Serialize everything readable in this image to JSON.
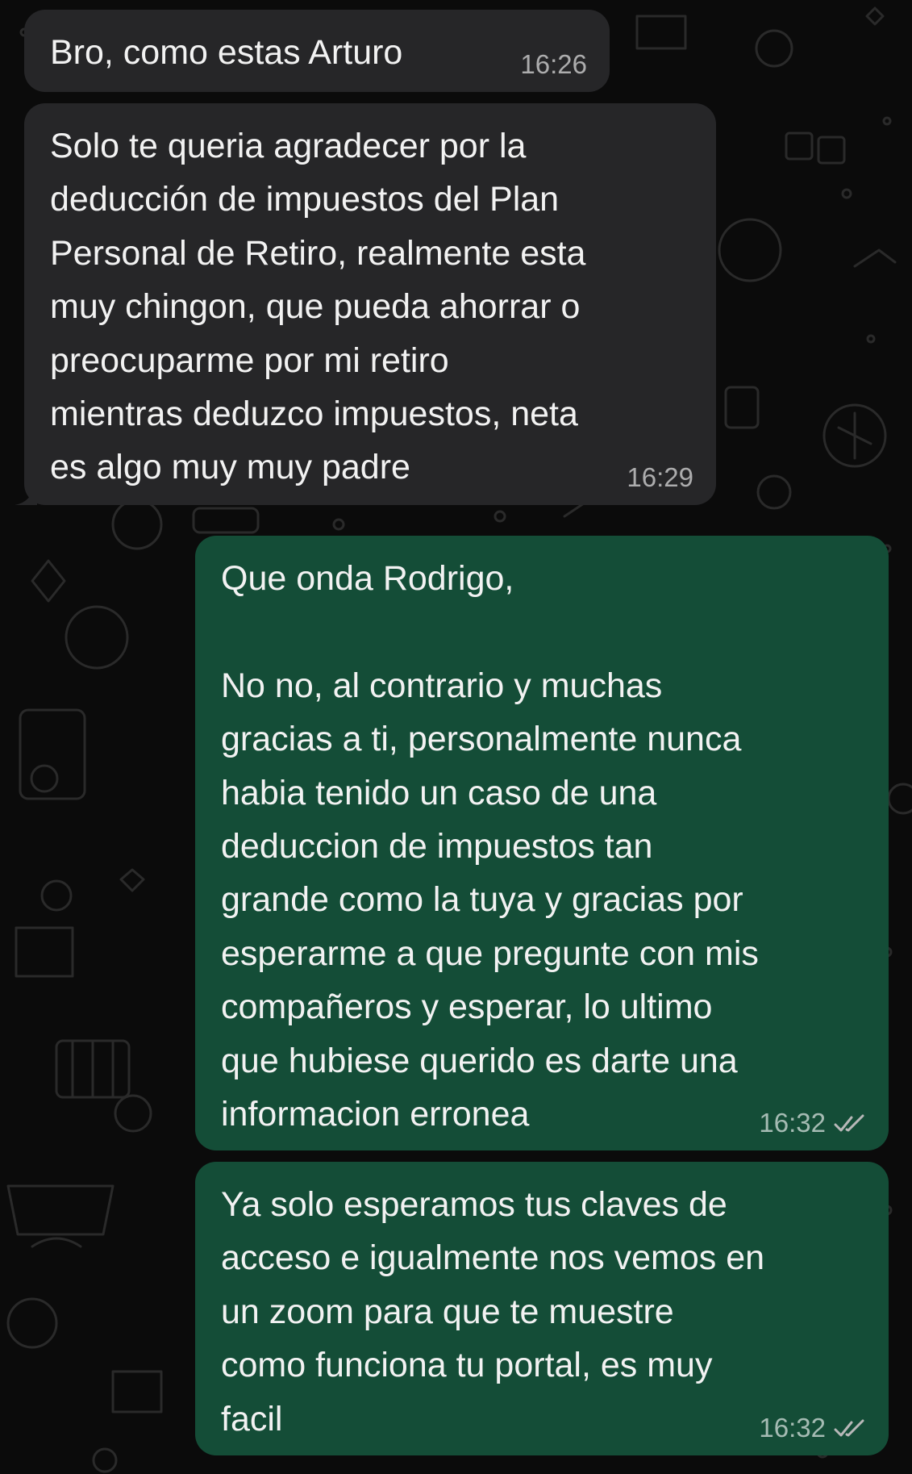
{
  "theme": {
    "background": "#0b0b0b",
    "incoming_bubble": "#262628",
    "outgoing_bubble": "#144d37",
    "text": "#f2f2f2",
    "meta_text": "#9a9a9a",
    "ticks": "#b8b8b8"
  },
  "messages": [
    {
      "direction": "incoming",
      "text": "Bro, como estas Arturo",
      "time": "16:26"
    },
    {
      "direction": "incoming",
      "text": "Solo te queria agradecer por la\ndeducción de impuestos del Plan\nPersonal de Retiro, realmente esta\nmuy chingon, que pueda ahorrar o\npreocuparme por mi retiro\nmientras deduzco impuestos, neta\nes algo muy muy padre",
      "time": "16:29"
    },
    {
      "direction": "outgoing",
      "text": "Que onda Rodrigo,\n\nNo no, al contrario y muchas\ngracias a ti, personalmente nunca\nhabia tenido un caso de una\ndeduccion de impuestos tan\ngrande como la tuya y gracias por\nesperarme a que pregunte con mis\ncompañeros y esperar, lo ultimo\nque hubiese querido es darte una\ninformacion erronea",
      "time": "16:32",
      "status_icon": "double-check-icon"
    },
    {
      "direction": "outgoing",
      "text": "Ya solo esperamos tus claves de\nacceso e igualmente nos vemos en\nun zoom para que te muestre\ncomo funciona tu portal, es muy\nfacil",
      "time": "16:32",
      "status_icon": "double-check-icon"
    }
  ]
}
